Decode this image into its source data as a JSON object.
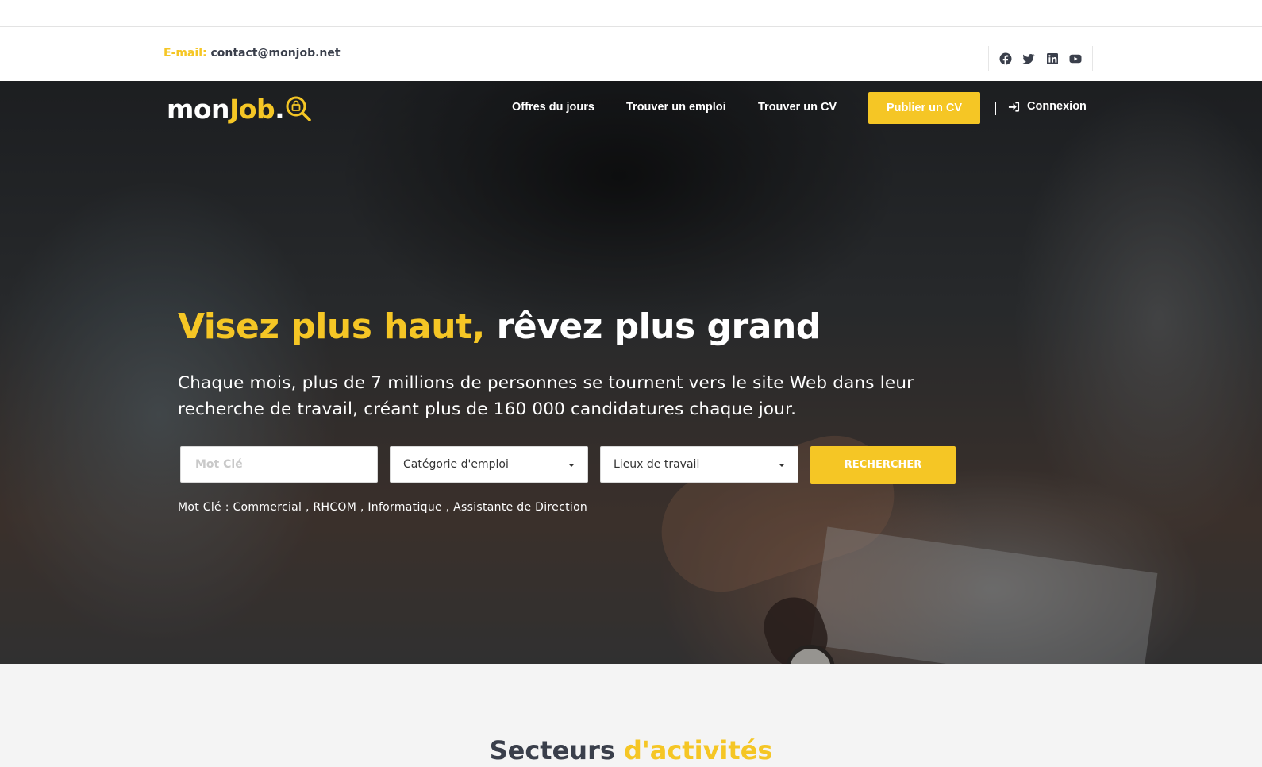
{
  "brand": {
    "name_part1": "mon",
    "name_part2": "Job",
    "name_dot": ".",
    "accent_color": "#f5c625",
    "dark_text_color": "#3a3f4b"
  },
  "contact": {
    "email_label": "E-mail:",
    "email_value": "contact@monjob.net"
  },
  "socials": [
    {
      "icon": "facebook-icon"
    },
    {
      "icon": "twitter-icon"
    },
    {
      "icon": "linkedin-icon"
    },
    {
      "icon": "youtube-icon"
    }
  ],
  "nav": {
    "items": [
      "Offres du jours",
      "Trouver un emploi",
      "Trouver un CV"
    ],
    "publish_cv": "Publier un CV",
    "login": "Connexion",
    "login_icon": "sign-in-icon"
  },
  "hero": {
    "headline_highlight": "Visez plus haut,",
    "headline_rest": "rêvez plus grand",
    "subtitle": "Chaque mois, plus de 7 millions de personnes se tournent vers le site Web dans leur recherche de travail, créant plus de 160 000 candidatures chaque jour."
  },
  "search": {
    "keyword_placeholder": "Mot Clé",
    "category_value": "Catégorie d'emploi",
    "location_value": "Lieux de travail",
    "button": "RECHERCHER",
    "suggestions": "Mot Clé : Commercial , RHCOM , Informatique , Assistante de Direction"
  },
  "sectors": {
    "title_part1": "Secteurs",
    "title_part2": "d'activités"
  }
}
